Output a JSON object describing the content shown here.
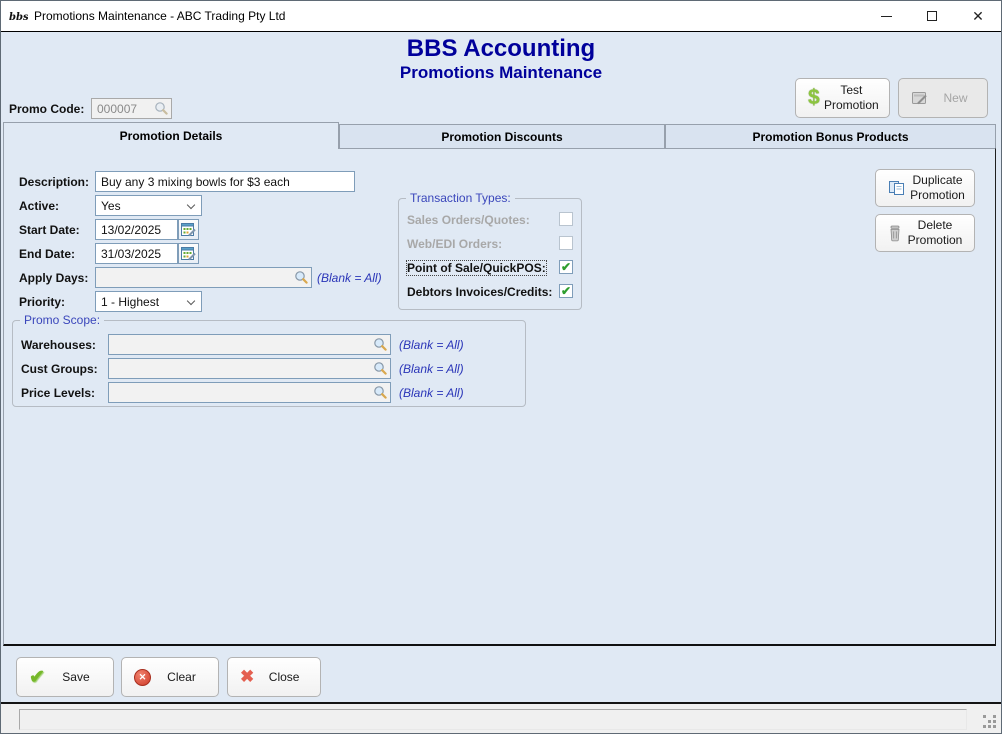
{
  "window": {
    "title": "Promotions Maintenance - ABC Trading Pty Ltd"
  },
  "header": {
    "app_title": "BBS Accounting",
    "screen_title": "Promotions Maintenance"
  },
  "toolbar": {
    "test_promotion_label": "Test Promotion",
    "new_label": "New"
  },
  "promo_code": {
    "label": "Promo Code:",
    "value": "000007"
  },
  "tabs": [
    {
      "label": "Promotion Details",
      "active": true
    },
    {
      "label": "Promotion Discounts",
      "active": false
    },
    {
      "label": "Promotion Bonus Products",
      "active": false
    }
  ],
  "form": {
    "description": {
      "label": "Description:",
      "value": "Buy any 3 mixing bowls for $3 each"
    },
    "active": {
      "label": "Active:",
      "value": "Yes"
    },
    "start_date": {
      "label": "Start Date:",
      "value": "13/02/2025"
    },
    "end_date": {
      "label": "End Date:",
      "value": "31/03/2025"
    },
    "apply_days": {
      "label": "Apply Days:",
      "value": "",
      "hint": "(Blank = All)"
    },
    "priority": {
      "label": "Priority:",
      "value": "1 - Highest"
    }
  },
  "transaction_types": {
    "legend": "Transaction Types:",
    "items": [
      {
        "label": "Sales Orders/Quotes:",
        "checked": false,
        "enabled": false
      },
      {
        "label": "Web/EDI Orders:",
        "checked": false,
        "enabled": false
      },
      {
        "label": "Point of Sale/QuickPOS:",
        "checked": true,
        "enabled": true,
        "focused": true
      },
      {
        "label": "Debtors Invoices/Credits:",
        "checked": true,
        "enabled": true
      }
    ]
  },
  "promo_scope": {
    "legend": "Promo Scope:",
    "items": [
      {
        "label": "Warehouses:",
        "value": "",
        "hint": "(Blank = All)"
      },
      {
        "label": "Cust Groups:",
        "value": "",
        "hint": "(Blank = All)"
      },
      {
        "label": "Price Levels:",
        "value": "",
        "hint": "(Blank = All)"
      }
    ]
  },
  "side_buttons": {
    "duplicate_label": "Duplicate Promotion",
    "delete_label": "Delete Promotion"
  },
  "footer_buttons": {
    "save_label": "Save",
    "clear_label": "Clear",
    "close_label": "Close"
  },
  "status_bar": {
    "message": ""
  },
  "icons": {
    "app_logo_text": "bbs",
    "dollar": "$",
    "check": "✔",
    "clear_x": "✕",
    "close_x": "✖",
    "window_close": "✕"
  },
  "colors": {
    "accent_navy": "#00009b",
    "legend_blue": "#3a46bb",
    "hint_blue": "#2a35b8",
    "check_green": "#2e9e2e"
  }
}
